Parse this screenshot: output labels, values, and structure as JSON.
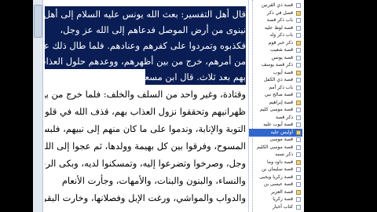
{
  "reader": {
    "lines": [
      "قال أهل التفسير: بعث الله يونس عليه السلام إلى أهل",
      "نينوى من أرض الموصل فدعاهم إلى الله عز وجل،",
      "فكذبوه وتمردوا على كفرهم وعنادهم. فلما طال ذلك عليه",
      "من أمرهم، خرج من بين أظهرهم، ووعدهم حلول العذاب",
      "بهم بعد ثلاث. قال ابن مسعود، ومجاهد، وسعيد بن جبير،",
      "وقتادة، وغير واحد من السلف والخلف: فلما خرج من بين",
      "ظهرانيهم وتحققوا نزول العذاب بهم، قذف الله في قلوبهم",
      "التوبة والإنابة، وندموا على ما كان منهم إلى نبيهم، فلبسوا",
      "المسوح، وفرقوا بين كل بهيمة وولدها، ثم عجوا إلى الله عز",
      "وجل، وصرخوا وتضرعوا إليه، وتمسكنوا لديه، وبكى الرجال",
      "والنساء، والبنون والبنات، والأمهات، وجأرت الأنعام",
      "والدواب والمواشي، ورغت الإبل وفصلانها، وخارت البقر"
    ]
  },
  "tree": {
    "items": [
      "قصة ذي القرنين",
      "فصل في ذكر",
      "باب ذكر قصة",
      "قصة لوط عليه",
      "باب ذكر ولد",
      "ذكر خبر قوم",
      "قصة شعيب",
      "قصة يونس",
      "ذكر قصة يوسف",
      "قصة أيوب",
      "قصة ذي الكفل",
      "باب ذكر أمم",
      "قصة صالح نبي",
      "قصة إبراهيم",
      "قصة موسى كليم",
      "ذكر قصة",
      "قصة أيوب عليه",
      "أوليس عليه",
      "قصة موسى",
      "قصة موسى الكليم",
      "ذكر نسبه",
      "قصة داود وما",
      "قصة سليمان بن",
      "قصة زكريا ويحيى",
      "قصة عيسى بن",
      "قصة العزير",
      "قصة زكريا",
      "كتاب أخبار"
    ],
    "active_index": 17
  }
}
